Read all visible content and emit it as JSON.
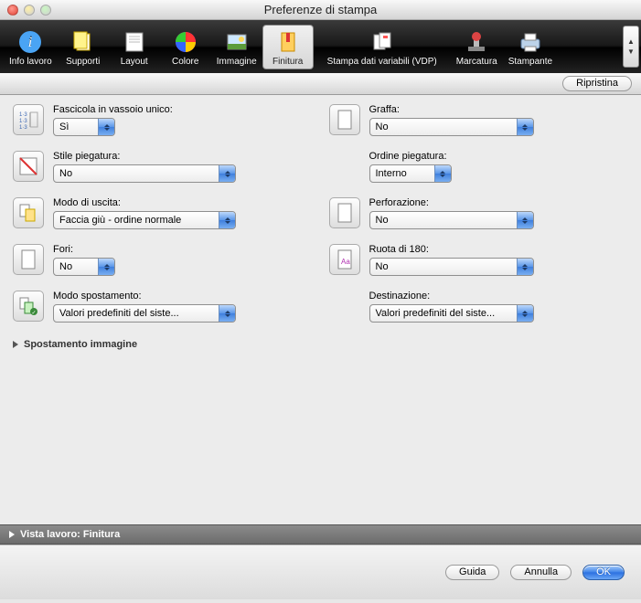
{
  "window": {
    "title": "Preferenze di stampa"
  },
  "toolbar": {
    "items": [
      {
        "label": "Info lavoro",
        "icon": "info"
      },
      {
        "label": "Supporti",
        "icon": "supports"
      },
      {
        "label": "Layout",
        "icon": "layout"
      },
      {
        "label": "Colore",
        "icon": "color"
      },
      {
        "label": "Immagine",
        "icon": "image"
      },
      {
        "label": "Finitura",
        "icon": "finish",
        "selected": true
      },
      {
        "label": "Stampa dati variabili (VDP)",
        "icon": "vdp"
      },
      {
        "label": "Marcatura",
        "icon": "stamp"
      },
      {
        "label": "Stampante",
        "icon": "printer"
      }
    ],
    "restore": "Ripristina"
  },
  "fields": {
    "fascicola": {
      "label": "Fascicola in vassoio unico:",
      "value": "Sì"
    },
    "graffa": {
      "label": "Graffa:",
      "value": "No"
    },
    "stile_piegatura": {
      "label": "Stile piegatura:",
      "value": "No"
    },
    "ordine_piegatura": {
      "label": "Ordine piegatura:",
      "value": "Interno"
    },
    "modo_uscita": {
      "label": "Modo di uscita:",
      "value": "Faccia giù - ordine normale"
    },
    "perforazione": {
      "label": "Perforazione:",
      "value": "No"
    },
    "fori": {
      "label": "Fori:",
      "value": "No"
    },
    "ruota": {
      "label": "Ruota di 180:",
      "value": "No"
    },
    "modo_spostamento": {
      "label": "Modo spostamento:",
      "value": "Valori predefiniti del siste..."
    },
    "destinazione": {
      "label": "Destinazione:",
      "value": "Valori predefiniti del siste..."
    }
  },
  "section": {
    "spostamento": "Spostamento immagine"
  },
  "vista": {
    "label": "Vista lavoro: Finitura"
  },
  "buttons": {
    "guida": "Guida",
    "annulla": "Annulla",
    "ok": "OK"
  }
}
